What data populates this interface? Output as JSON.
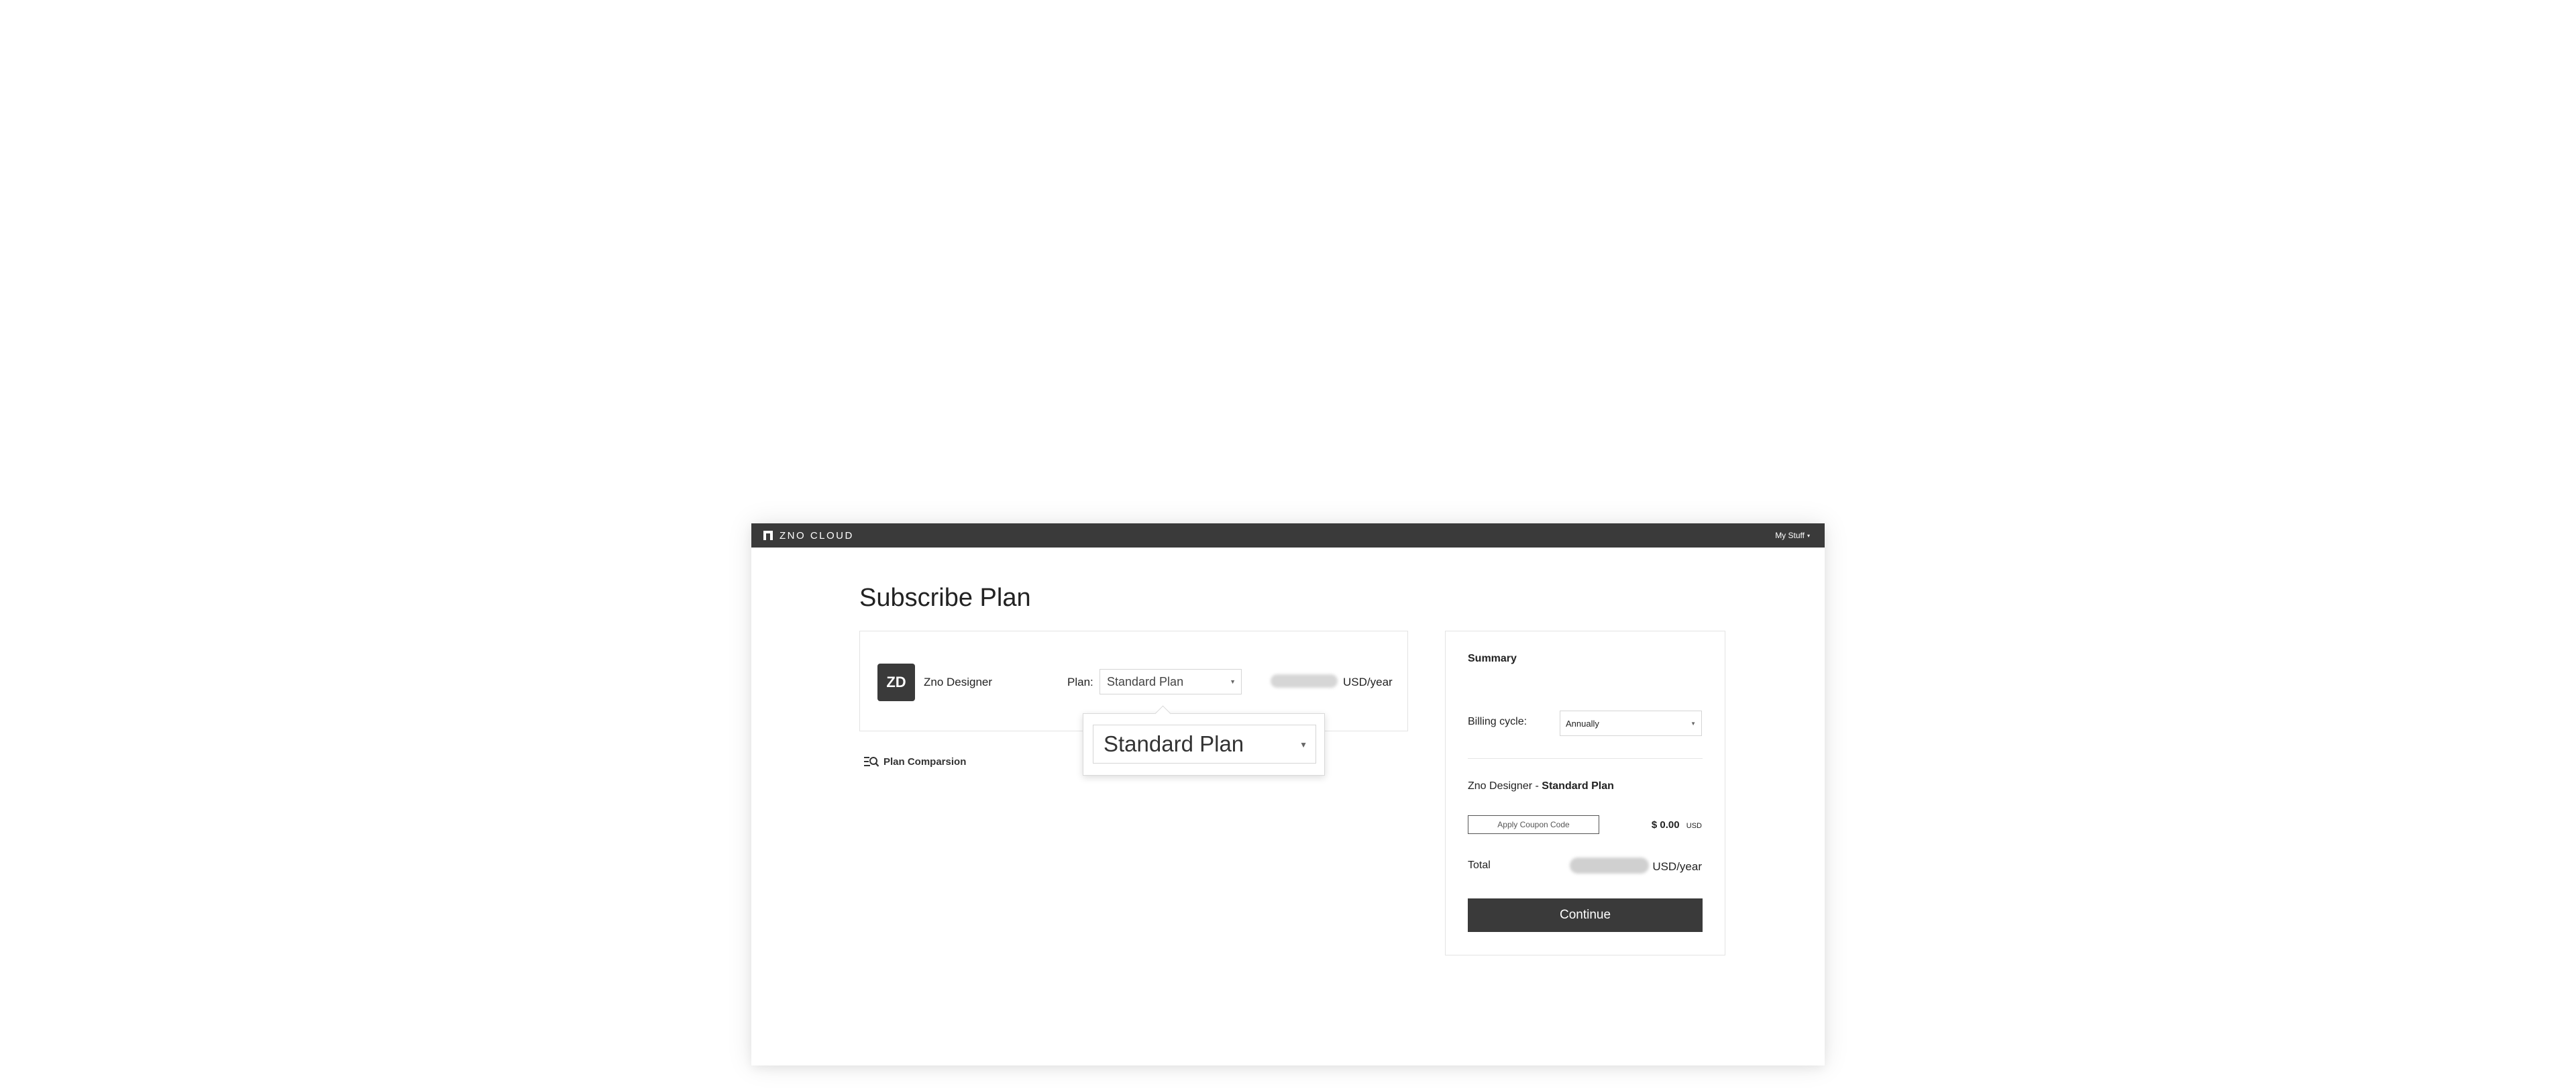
{
  "header": {
    "brand": "ZNO CLOUD",
    "menu_label": "My Stuff",
    "menu_caret": "▾"
  },
  "page": {
    "title": "Subscribe Plan"
  },
  "plan_card": {
    "avatar_text": "ZD",
    "product_name": "Zno Designer",
    "plan_label": "Plan:",
    "plan_selected": "Standard Plan",
    "price_unit": "USD/year"
  },
  "plan_dropdown": {
    "selected": "Standard Plan"
  },
  "plan_comparison": {
    "label": "Plan Comparsion"
  },
  "summary": {
    "title": "Summary",
    "billing_label": "Billing cycle:",
    "billing_selected": "Annually",
    "product_line": "Zno Designer -",
    "plan_name": "Standard Plan",
    "coupon_button": "Apply Coupon Code",
    "discount_amount": "$ 0.00",
    "discount_currency": "USD",
    "total_label": "Total",
    "total_unit": "USD/year",
    "continue_button": "Continue"
  },
  "colors": {
    "dark": "#3a3a3a",
    "border": "#e3e3e3"
  }
}
